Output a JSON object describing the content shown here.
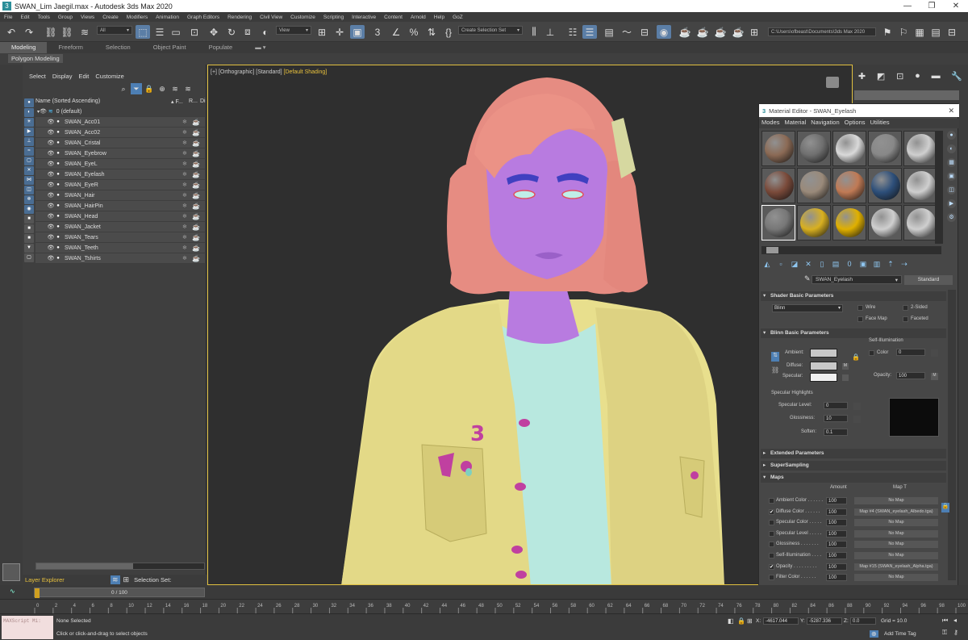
{
  "window": {
    "title": "SWAN_Lim Jaegil.max - Autodesk 3ds Max 2020",
    "controls": [
      "—",
      "❐",
      "✕"
    ]
  },
  "menu": [
    "File",
    "Edit",
    "Tools",
    "Group",
    "Views",
    "Create",
    "Modifiers",
    "Animation",
    "Graph Editors",
    "Rendering",
    "Civil View",
    "Customize",
    "Scripting",
    "Interactive",
    "Content",
    "Arnold",
    "Help",
    "GoZ"
  ],
  "toolbar": {
    "filter": "All",
    "coord": "View",
    "selset": "Create Selection Set",
    "path": "C:\\Users\\ofbeast\\Documents\\3ds Max 2020"
  },
  "ribbon": {
    "tabs": [
      "Modeling",
      "Freeform",
      "Selection",
      "Object Paint",
      "Populate"
    ],
    "active_tab": "Modeling",
    "sub": "Polygon Modeling"
  },
  "scene_explorer": {
    "menu": [
      "Select",
      "Display",
      "Edit",
      "Customize"
    ],
    "header": {
      "name": "Name (Sorted Ascending)",
      "freeze": "▴ F...",
      "render": "R...",
      "di": "Di"
    },
    "root": "0 (default)",
    "items": [
      "SWAN_Acc01",
      "SWAN_Acc02",
      "SWAN_Cristal",
      "SWAN_Eyebrow",
      "SWAN_EyeL",
      "SWAN_Eyelash",
      "SWAN_EyeR",
      "SWAN_Hair",
      "SWAN_HairPin",
      "SWAN_Head",
      "SWAN_Jacket",
      "SWAN_Tears",
      "SWAN_Teeth",
      "SWAN_Tshirts"
    ],
    "layer_explorer": "Layer Explorer",
    "selection_set": "Selection Set:"
  },
  "viewport": {
    "plus": "[+]",
    "view": "[Orthographic]",
    "shading_mode": "[Standard]",
    "shading": "[Default Shading]"
  },
  "material_editor": {
    "title": "Material Editor - SWAN_Eyelash",
    "menu": [
      "Modes",
      "Material",
      "Navigation",
      "Options",
      "Utilities"
    ],
    "material_name": "SWAN_Eyelash",
    "material_type": "Standard",
    "slot_colors": [
      "#8b6a55",
      "#6f6f6f",
      "#d9d9d9",
      "#888888",
      "#cfcfcf",
      "#7a4a3a",
      "#9a8a7a",
      "#c07a55",
      "#2d4f7a",
      "#cfcfcf",
      "#777777",
      "#d8b020",
      "#e0b000",
      "#cfcfcf",
      "#cfcfcf"
    ],
    "shader_basic": {
      "title": "Shader Basic Parameters",
      "shader": "Blinn",
      "wire": "Wire",
      "two_sided": "2-Sided",
      "face_map": "Face Map",
      "faceted": "Faceted"
    },
    "blinn_basic": {
      "title": "Blinn Basic Parameters",
      "self_illum": "Self-Illumination",
      "ambient": "Ambient:",
      "diffuse": "Diffuse:",
      "specular": "Specular:",
      "color": "Color",
      "color_val": "0",
      "opacity": "Opacity:",
      "opacity_val": "100",
      "m": "M",
      "spec_title": "Specular Highlights",
      "spec_level": "Specular Level:",
      "spec_level_val": "0",
      "glossiness": "Glossiness:",
      "glossiness_val": "10",
      "soften": "Soften:",
      "soften_val": "0.1"
    },
    "extended": "Extended Parameters",
    "supersampling": "SuperSampling",
    "maps": {
      "title": "Maps",
      "amount_header": "Amount",
      "map_header": "Map T",
      "rows": [
        {
          "label": "Ambient Color . . . . . .",
          "amount": "100",
          "map": "No Map",
          "checked": ""
        },
        {
          "label": "Diffuse Color . . . . . .",
          "amount": "100",
          "map": "Map #4 (SWAN_eyelash_Albedo.tga)",
          "checked": "✔"
        },
        {
          "label": "Specular Color . . . . .",
          "amount": "100",
          "map": "No Map",
          "checked": ""
        },
        {
          "label": "Specular Level . . . . .",
          "amount": "100",
          "map": "No Map",
          "checked": ""
        },
        {
          "label": "Glossiness . . . . . . .",
          "amount": "100",
          "map": "No Map",
          "checked": ""
        },
        {
          "label": "Self-Illumination . . . .",
          "amount": "100",
          "map": "No Map",
          "checked": ""
        },
        {
          "label": "Opacity . . . . . . . . .",
          "amount": "100",
          "map": "Map #15 (SWAN_eyelash_Alpha.tga)",
          "checked": "✔"
        },
        {
          "label": "Filter Color . . . . . .",
          "amount": "100",
          "map": "No Map",
          "checked": ""
        }
      ]
    }
  },
  "timeline": {
    "frame": "0 / 100",
    "ticks": [
      "0",
      "2",
      "4",
      "6",
      "8",
      "10",
      "12",
      "14",
      "16",
      "18",
      "20",
      "22",
      "24",
      "26",
      "28",
      "30",
      "32",
      "34",
      "36",
      "38",
      "40",
      "42",
      "44",
      "46",
      "48",
      "50",
      "52",
      "54",
      "56",
      "58",
      "60",
      "62",
      "64",
      "66",
      "68",
      "70",
      "72",
      "74",
      "76",
      "78",
      "80",
      "82",
      "84",
      "86",
      "88",
      "90",
      "92",
      "94",
      "96",
      "98",
      "100"
    ]
  },
  "status": {
    "maxscript": "MAXScript Mi:",
    "selected": "None Selected",
    "hint": "Click or click-and-drag to select objects",
    "x_label": "X:",
    "x": "-4617.044",
    "y_label": "Y:",
    "y": "-5287.336",
    "z_label": "Z:",
    "z": "0.0",
    "grid": "Grid = 10.0",
    "add_time_tag": "Add Time Tag"
  }
}
